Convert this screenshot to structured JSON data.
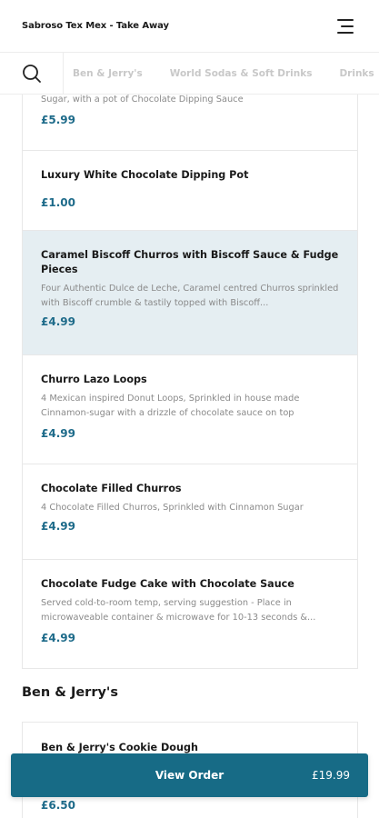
{
  "header": {
    "title": "Sabroso Tex Mex - Take Away"
  },
  "categories": [
    "Ben & Jerry's",
    "World Sodas & Soft Drinks",
    "Drinks"
  ],
  "items": [
    {
      "name": "",
      "desc": "Sugar, with a pot of Chocolate Dipping Sauce",
      "price": "£5.99"
    },
    {
      "name": "Luxury White Chocolate Dipping Pot",
      "desc": "",
      "price": "£1.00"
    },
    {
      "name": "Caramel Biscoff Churros with Biscoff Sauce & Fudge Pieces",
      "desc": "Four Authentic Dulce de Leche, Caramel centred Churros sprinkled with Biscoff crumble & tastily topped with Biscoff...",
      "price": "£4.99"
    },
    {
      "name": "Churro Lazo Loops",
      "desc": "4 Mexican inspired Donut Loops, Sprinkled in house made Cinnamon-sugar with a drizzle of chocolate sauce on top",
      "price": "£4.99"
    },
    {
      "name": "Chocolate Filled Churros",
      "desc": "4 Chocolate Filled Churros, Sprinkled with Cinnamon Sugar",
      "price": "£4.99"
    },
    {
      "name": "Chocolate Fudge Cake with Chocolate Sauce",
      "desc": "Served cold-to-room temp, serving suggestion - Place in microwaveable container & microwave for 10-13 seconds &...",
      "price": "£4.99"
    }
  ],
  "section": {
    "title": "Ben & Jerry's",
    "items": [
      {
        "name": "Ben & Jerry's Cookie Dough",
        "price": "£6.50"
      }
    ]
  },
  "order_bar": {
    "label": "View Order",
    "total": "£19.99"
  },
  "colors": {
    "accent": "#176b86",
    "price": "#1e6b8a",
    "highlight": "#e5eef2"
  },
  "icons": {
    "search": "search-icon",
    "menu": "hamburger-menu-icon"
  }
}
